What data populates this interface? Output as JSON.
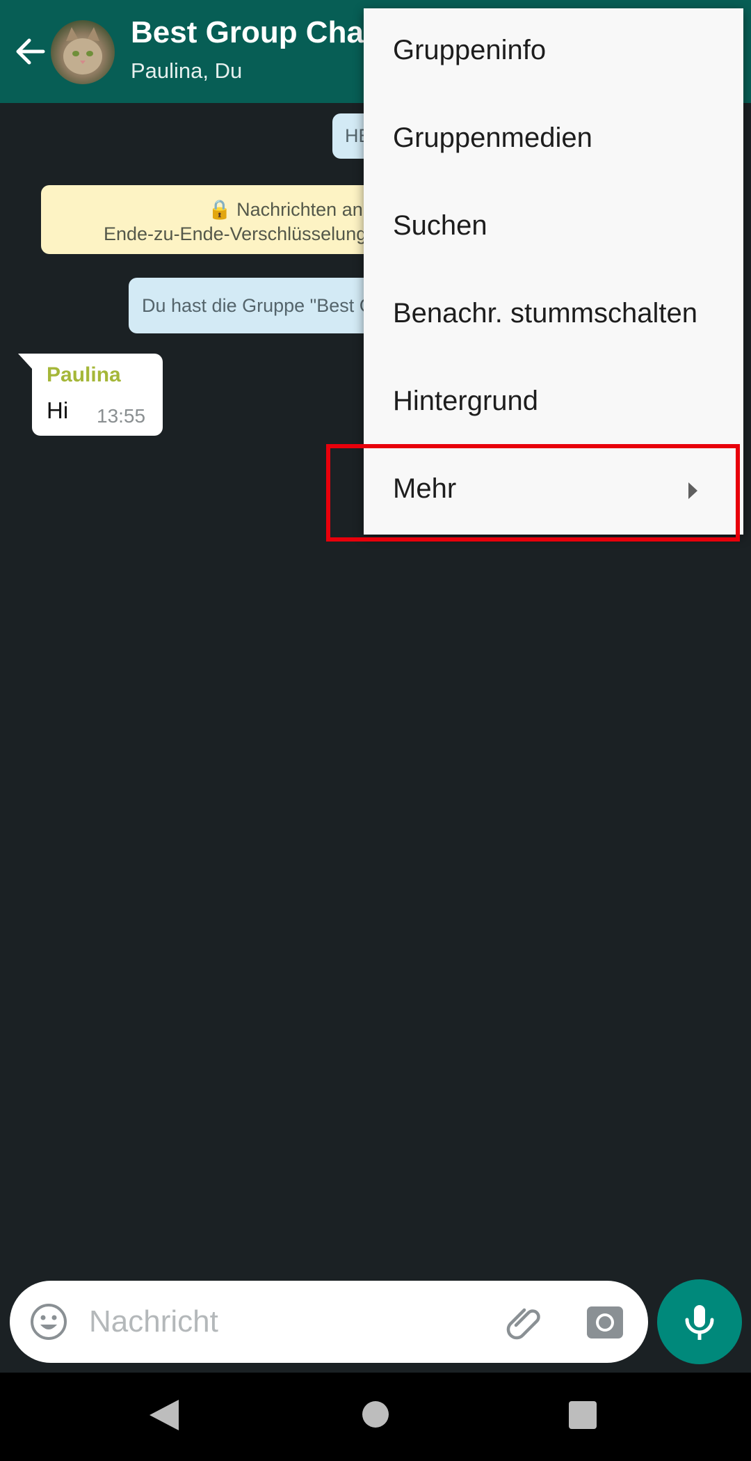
{
  "header": {
    "title": "Best Group Chat",
    "subtitle": "Paulina, Du"
  },
  "chat": {
    "top_bubble": "HE",
    "encryption_line1": "🔒 Nachrichten an die",
    "encryption_line2": "Ende-zu-Ende-Verschlüsselung",
    "created_notice": "Du hast die Gruppe \"Best G",
    "message": {
      "sender": "Paulina",
      "text": "Hi",
      "time": "13:55"
    }
  },
  "menu": {
    "items": [
      {
        "label": "Gruppeninfo"
      },
      {
        "label": "Gruppenmedien"
      },
      {
        "label": "Suchen"
      },
      {
        "label": "Benachr. stummschalten"
      },
      {
        "label": "Hintergrund"
      },
      {
        "label": "Mehr"
      }
    ]
  },
  "input": {
    "placeholder": "Nachricht"
  },
  "colors": {
    "header": "#075e55",
    "chat_bg": "#1b2124",
    "accent": "#00897b",
    "highlight": "#e8000b"
  },
  "icons": [
    "back-arrow-icon",
    "emoji-icon",
    "attach-icon",
    "camera-icon",
    "mic-icon",
    "nav-back-icon",
    "nav-home-icon",
    "nav-recents-icon"
  ]
}
